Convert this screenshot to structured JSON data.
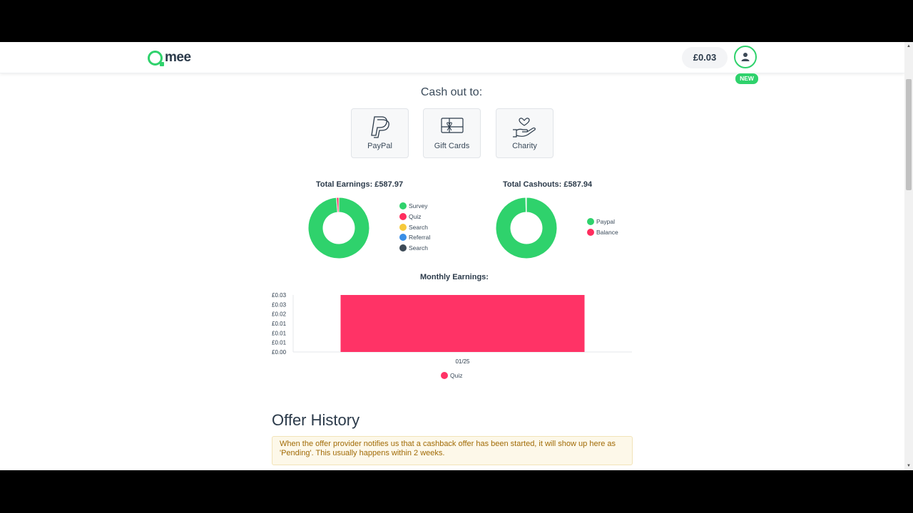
{
  "header": {
    "logo_text": "mee",
    "balance": "£0.03",
    "badge": "NEW"
  },
  "cashout": {
    "title": "Cash out to:",
    "options": [
      {
        "label": "PayPal",
        "icon": "paypal-icon"
      },
      {
        "label": "Gift Cards",
        "icon": "gift-card-icon"
      },
      {
        "label": "Charity",
        "icon": "charity-hand-heart-icon"
      }
    ]
  },
  "earnings": {
    "title": "Total Earnings: £587.97",
    "legend": [
      {
        "label": "Survey",
        "color": "#2fd26c"
      },
      {
        "label": "Quiz",
        "color": "#ff2d5e"
      },
      {
        "label": "Search",
        "color": "#f6c93b"
      },
      {
        "label": "Referral",
        "color": "#3a8ee6"
      },
      {
        "label": "Search",
        "color": "#3d4a57"
      }
    ]
  },
  "cashouts": {
    "title": "Total Cashouts: £587.94",
    "legend": [
      {
        "label": "Paypal",
        "color": "#2fd26c"
      },
      {
        "label": "Balance",
        "color": "#ff2d5e"
      }
    ]
  },
  "chart_data": [
    {
      "type": "pie",
      "title": "Total Earnings: £587.97",
      "categories": [
        "Survey",
        "Quiz",
        "Search",
        "Referral",
        "Search"
      ],
      "values": [
        98.8,
        1.2,
        0,
        0,
        0
      ],
      "colors": [
        "#2fd26c",
        "#ff2d5e",
        "#f6c93b",
        "#3a8ee6",
        "#3d4a57"
      ],
      "legend": "right"
    },
    {
      "type": "pie",
      "title": "Total Cashouts: £587.94",
      "categories": [
        "Paypal",
        "Balance"
      ],
      "values": [
        99.7,
        0.3
      ],
      "colors": [
        "#2fd26c",
        "#ff2d5e"
      ],
      "legend": "right"
    },
    {
      "type": "bar",
      "title": "Monthly Earnings:",
      "categories": [
        "01/25"
      ],
      "series": [
        {
          "name": "Quiz",
          "values": [
            0.03
          ],
          "color": "#ff3366"
        }
      ],
      "ylim": [
        0,
        0.03
      ],
      "yticks": [
        "£0.03",
        "£0.03",
        "£0.02",
        "£0.01",
        "£0.01",
        "£0.01",
        "£0.00"
      ],
      "legend": "bottom"
    }
  ],
  "offers": {
    "title": "Offer History",
    "note": "When the offer provider notifies us that a cashback offer has been started, it will show up here as 'Pending'. This usually happens within 2 weeks."
  }
}
